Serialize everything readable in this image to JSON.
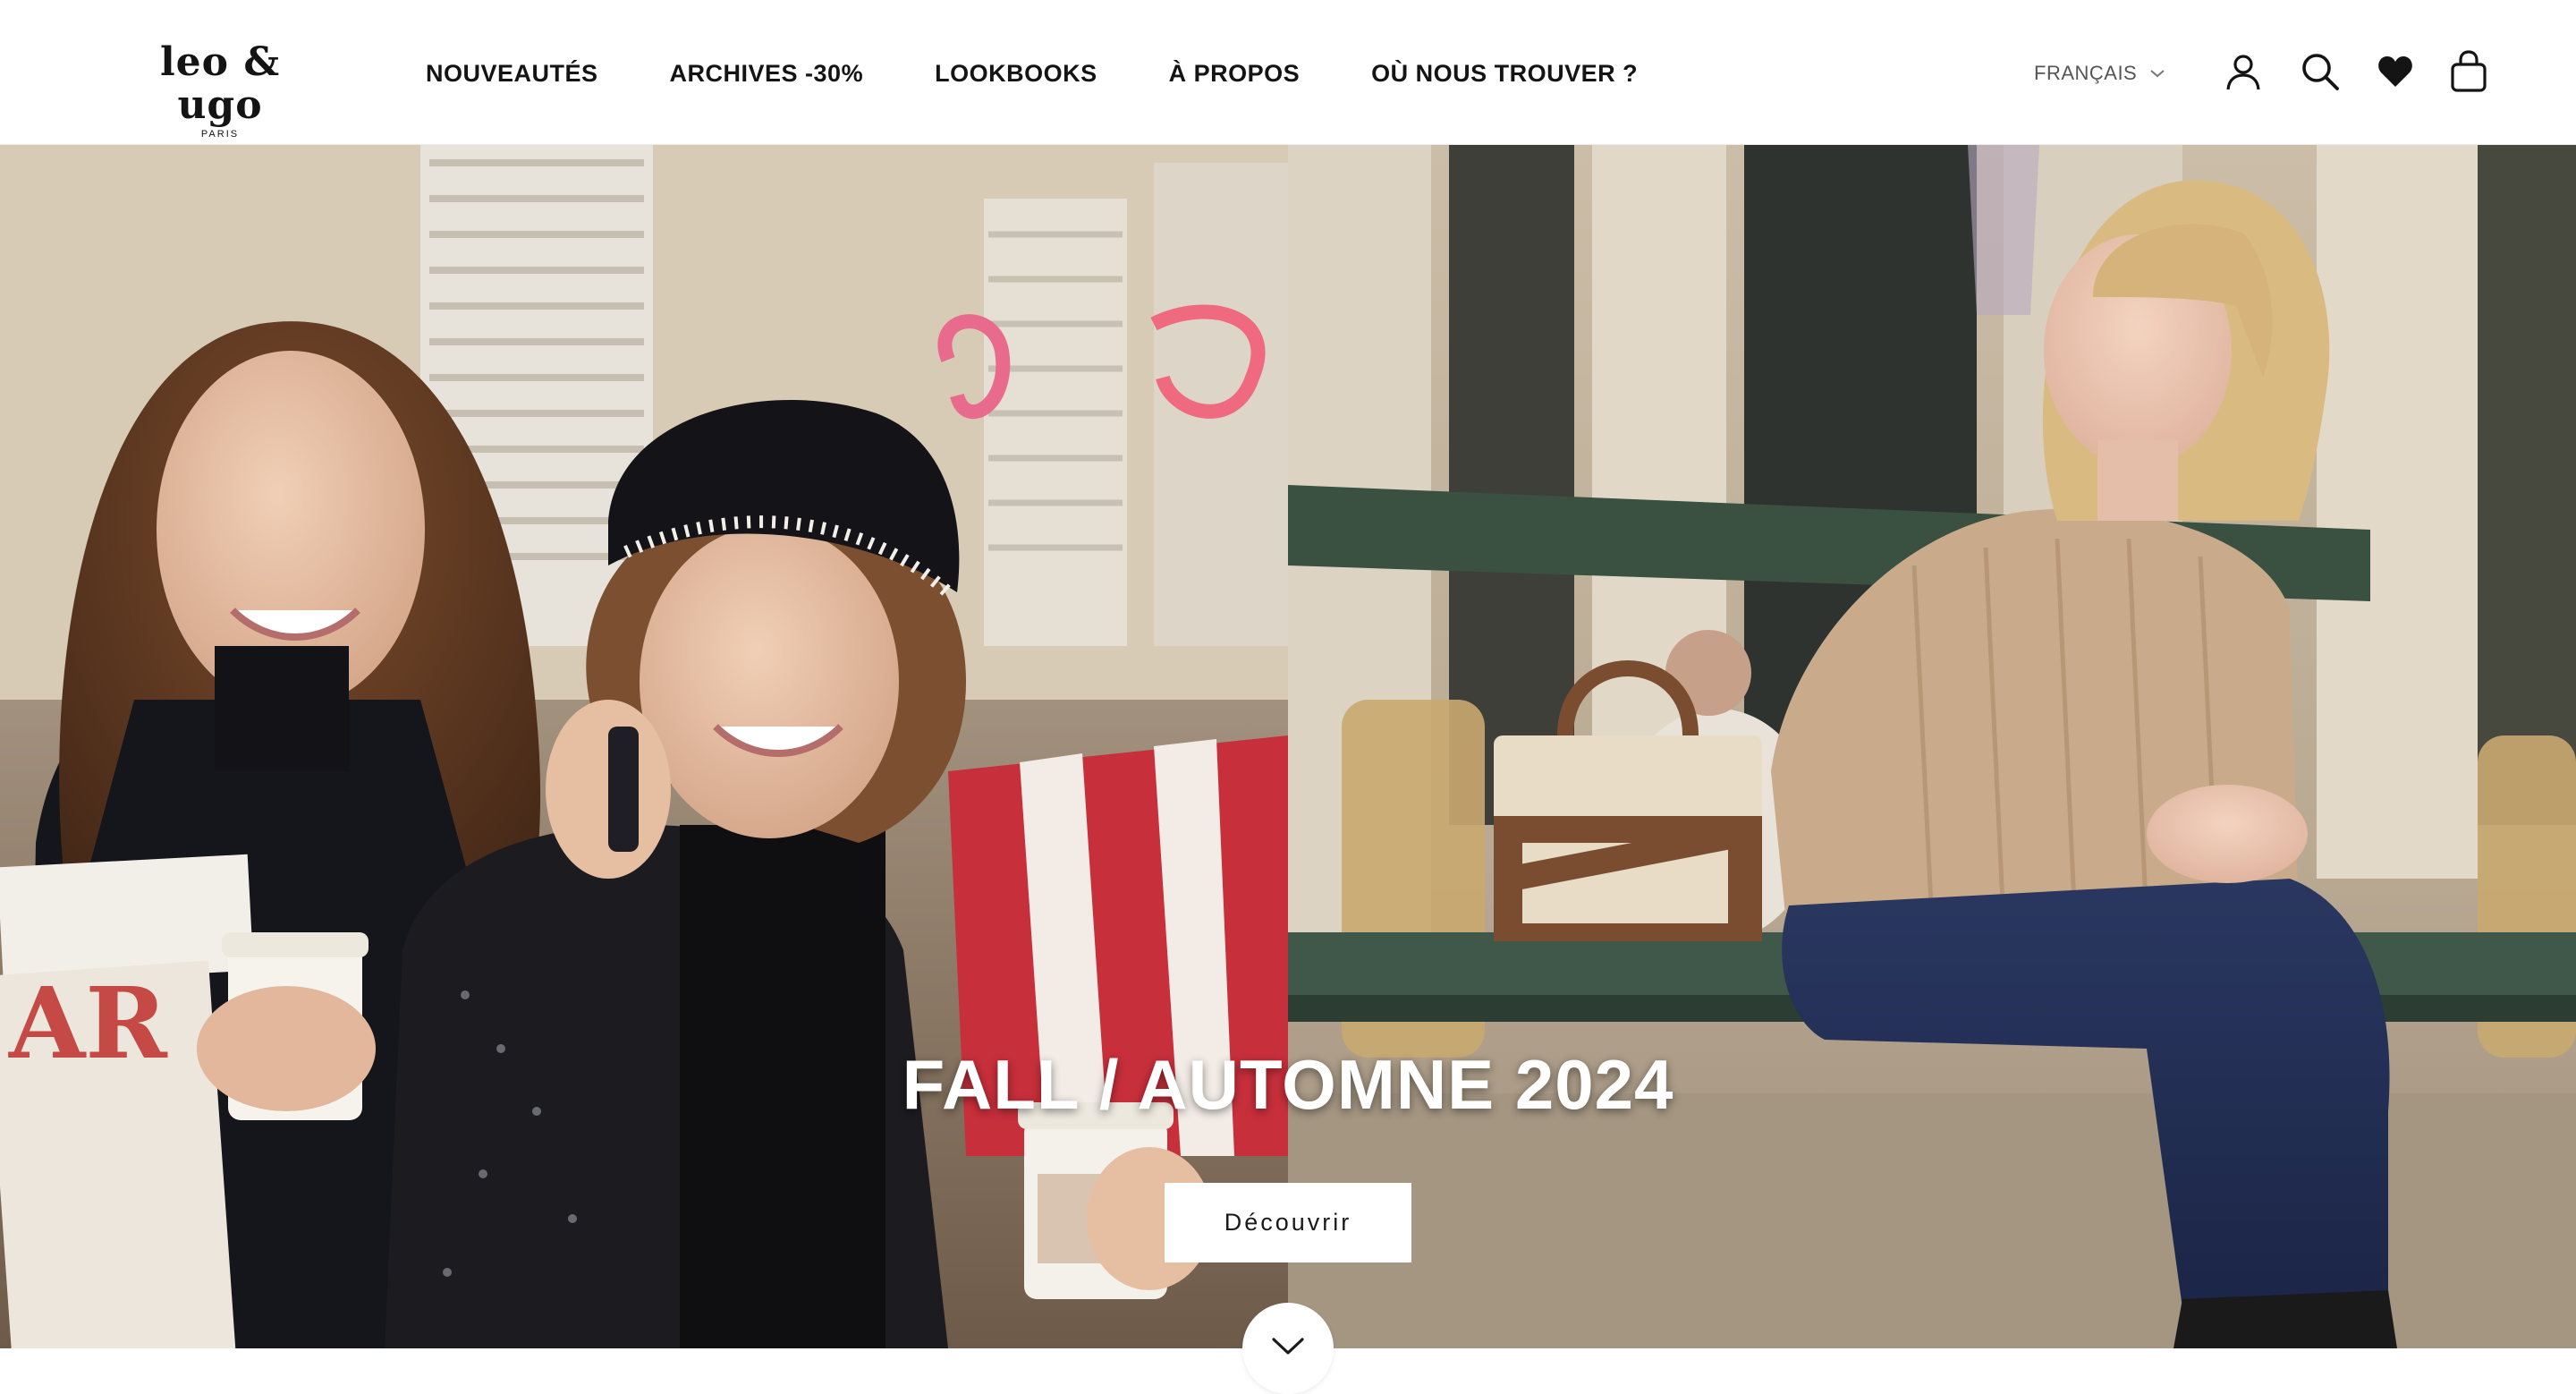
{
  "brand": {
    "name": "leo & ugo",
    "tagline": "PARIS"
  },
  "nav": {
    "items": [
      {
        "label": "NOUVEAUTÉS"
      },
      {
        "label": "ARCHIVES -30%"
      },
      {
        "label": "LOOKBOOKS"
      },
      {
        "label": "À PROPOS"
      },
      {
        "label": "OÙ NOUS TROUVER ?"
      }
    ]
  },
  "header": {
    "language": "FRANÇAIS",
    "icons": [
      "account-icon",
      "search-icon",
      "wishlist-heart-icon",
      "cart-bag-icon",
      "chevron-down-icon"
    ]
  },
  "hero": {
    "title": "FALL / AUTOMNE 2024",
    "cta_label": "Découvrir",
    "scroll_icon": "chevron-down-icon"
  },
  "colors": {
    "text": "#141414",
    "background": "#ffffff",
    "cta_bg": "#ffffff"
  }
}
